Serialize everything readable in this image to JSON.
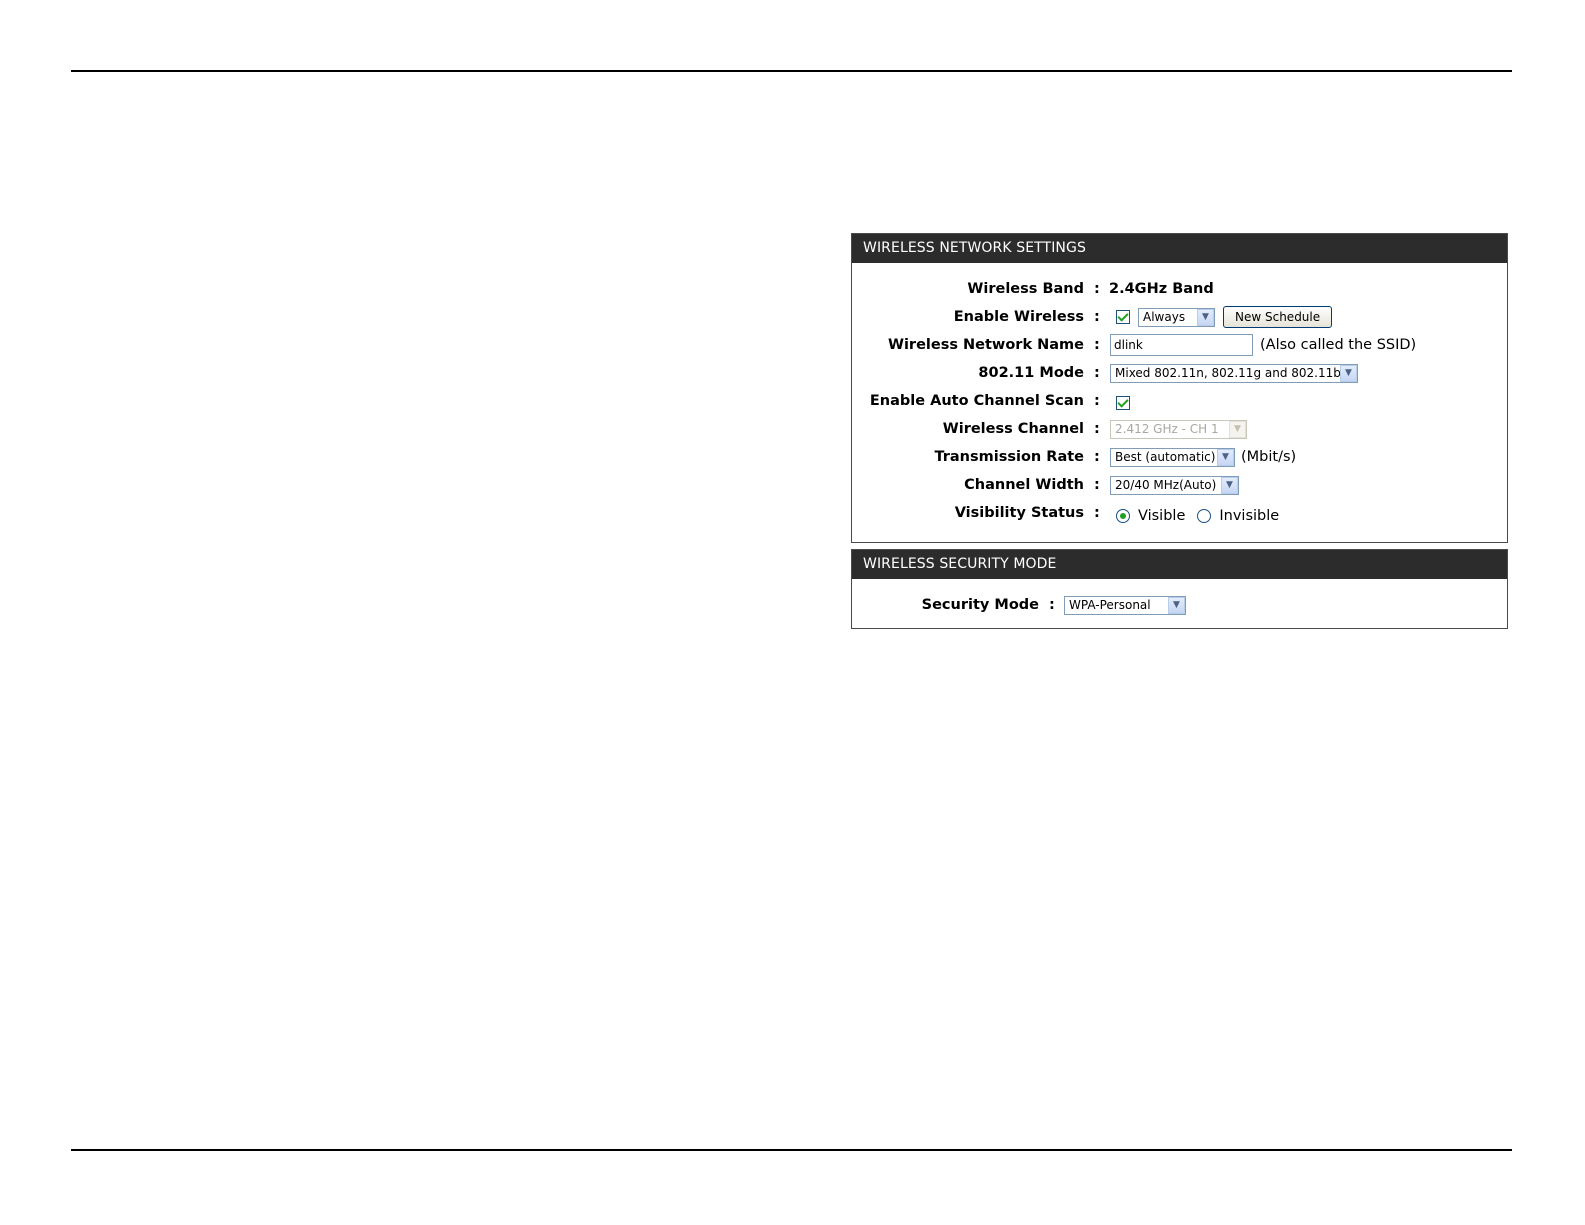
{
  "wireless_network_settings": {
    "header": "WIRELESS NETWORK SETTINGS",
    "wireless_band": {
      "label": "Wireless Band",
      "value": "2.4GHz Band"
    },
    "enable_wireless": {
      "label": "Enable Wireless",
      "checked": true,
      "schedule": "Always",
      "new_schedule_button": "New Schedule"
    },
    "network_name": {
      "label": "Wireless Network Name",
      "value": "dlink",
      "hint": "(Also called the SSID)"
    },
    "mode": {
      "label": "802.11 Mode",
      "value": "Mixed 802.11n, 802.11g and 802.11b"
    },
    "auto_channel": {
      "label": "Enable Auto Channel Scan",
      "checked": true
    },
    "channel": {
      "label": "Wireless Channel",
      "value": "2.412 GHz - CH 1"
    },
    "tx_rate": {
      "label": "Transmission Rate",
      "value": "Best (automatic)",
      "unit": "(Mbit/s)"
    },
    "channel_width": {
      "label": "Channel Width",
      "value": "20/40 MHz(Auto)"
    },
    "visibility": {
      "label": "Visibility Status",
      "options": [
        "Visible",
        "Invisible"
      ],
      "selected": "Visible"
    }
  },
  "wireless_security_mode": {
    "header": "WIRELESS SECURITY MODE",
    "security_mode": {
      "label": "Security Mode",
      "value": "WPA-Personal"
    }
  },
  "colon": ":",
  "icons": {
    "dropdown": "chevron-down-icon"
  }
}
